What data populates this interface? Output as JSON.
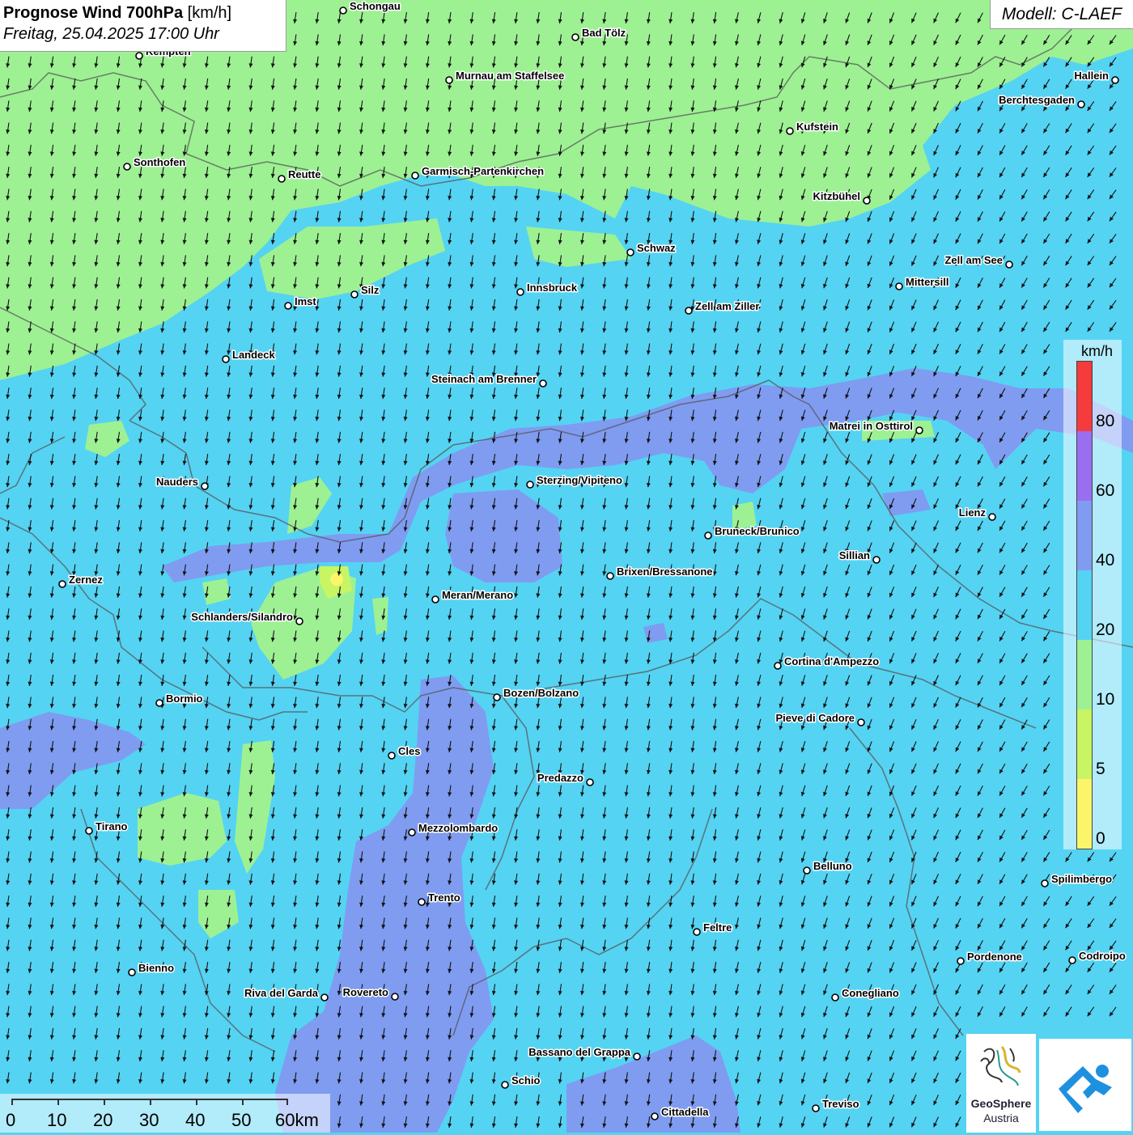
{
  "title": {
    "main_bold": "Prognose Wind 700hPa",
    "main_unit": "[km/h]",
    "subtitle": "Freitag, 25.04.2025 17:00 Uhr"
  },
  "model_label": "Modell: C-LAEF",
  "legend": {
    "unit": "km/h",
    "ticks": [
      "80",
      "60",
      "40",
      "20",
      "10",
      "5",
      "0"
    ],
    "colors": {
      "0-5": "#fbf56a",
      "5-10": "#c8f563",
      "10-20": "#9df193",
      "20-40": "#55d3f3",
      "40-60": "#7f9cf1",
      "60-80": "#9a6ef1",
      "80+": "#f53b3b"
    }
  },
  "scale_bar": {
    "labels": [
      "0",
      "10",
      "20",
      "30",
      "40",
      "50",
      "60km"
    ]
  },
  "branding": {
    "logo_line1": "GeoSphere",
    "logo_line2": "Austria"
  },
  "wind_field": {
    "predominant_direction": "from north (arrows pointing south)",
    "arrow_icon": "arrow-down-icon"
  },
  "cities": [
    {
      "name": "Schongau"
    },
    {
      "name": "Kempten"
    },
    {
      "name": "Bad Tölz"
    },
    {
      "name": "Murnau am Staffelsee"
    },
    {
      "name": "Hallein"
    },
    {
      "name": "Berchtesgaden"
    },
    {
      "name": "Kufstein"
    },
    {
      "name": "Sonthofen"
    },
    {
      "name": "Reutte"
    },
    {
      "name": "Garmisch-Partenkirchen"
    },
    {
      "name": "Kitzbühel"
    },
    {
      "name": "Schwaz"
    },
    {
      "name": "Zell am See"
    },
    {
      "name": "Mittersill"
    },
    {
      "name": "Innsbruck"
    },
    {
      "name": "Silz"
    },
    {
      "name": "Imst"
    },
    {
      "name": "Zell am Ziller"
    },
    {
      "name": "Landeck"
    },
    {
      "name": "Steinach am Brenner"
    },
    {
      "name": "Matrei in Osttirol"
    },
    {
      "name": "Nauders"
    },
    {
      "name": "Sterzing/Vipiteno"
    },
    {
      "name": "Lienz"
    },
    {
      "name": "Bruneck/Brunico"
    },
    {
      "name": "Sillian"
    },
    {
      "name": "Brixen/Bressanone"
    },
    {
      "name": "Zernez"
    },
    {
      "name": "Meran/Merano"
    },
    {
      "name": "Schlanders/Silandro"
    },
    {
      "name": "Cortina d'Ampezzo"
    },
    {
      "name": "Bozen/Bolzano"
    },
    {
      "name": "Bormio"
    },
    {
      "name": "Pieve di Cadore"
    },
    {
      "name": "Cles"
    },
    {
      "name": "Predazzo"
    },
    {
      "name": "Tirano"
    },
    {
      "name": "Mezzolombardo"
    },
    {
      "name": "Belluno"
    },
    {
      "name": "Spilimbergo"
    },
    {
      "name": "Trento"
    },
    {
      "name": "Feltre"
    },
    {
      "name": "Pordenone"
    },
    {
      "name": "Codroipo"
    },
    {
      "name": "Bienno"
    },
    {
      "name": "Riva del Garda"
    },
    {
      "name": "Rovereto"
    },
    {
      "name": "Conegliano"
    },
    {
      "name": "Bassano del Grappa"
    },
    {
      "name": "Schio"
    },
    {
      "name": "Treviso"
    },
    {
      "name": "Cittadella"
    }
  ]
}
